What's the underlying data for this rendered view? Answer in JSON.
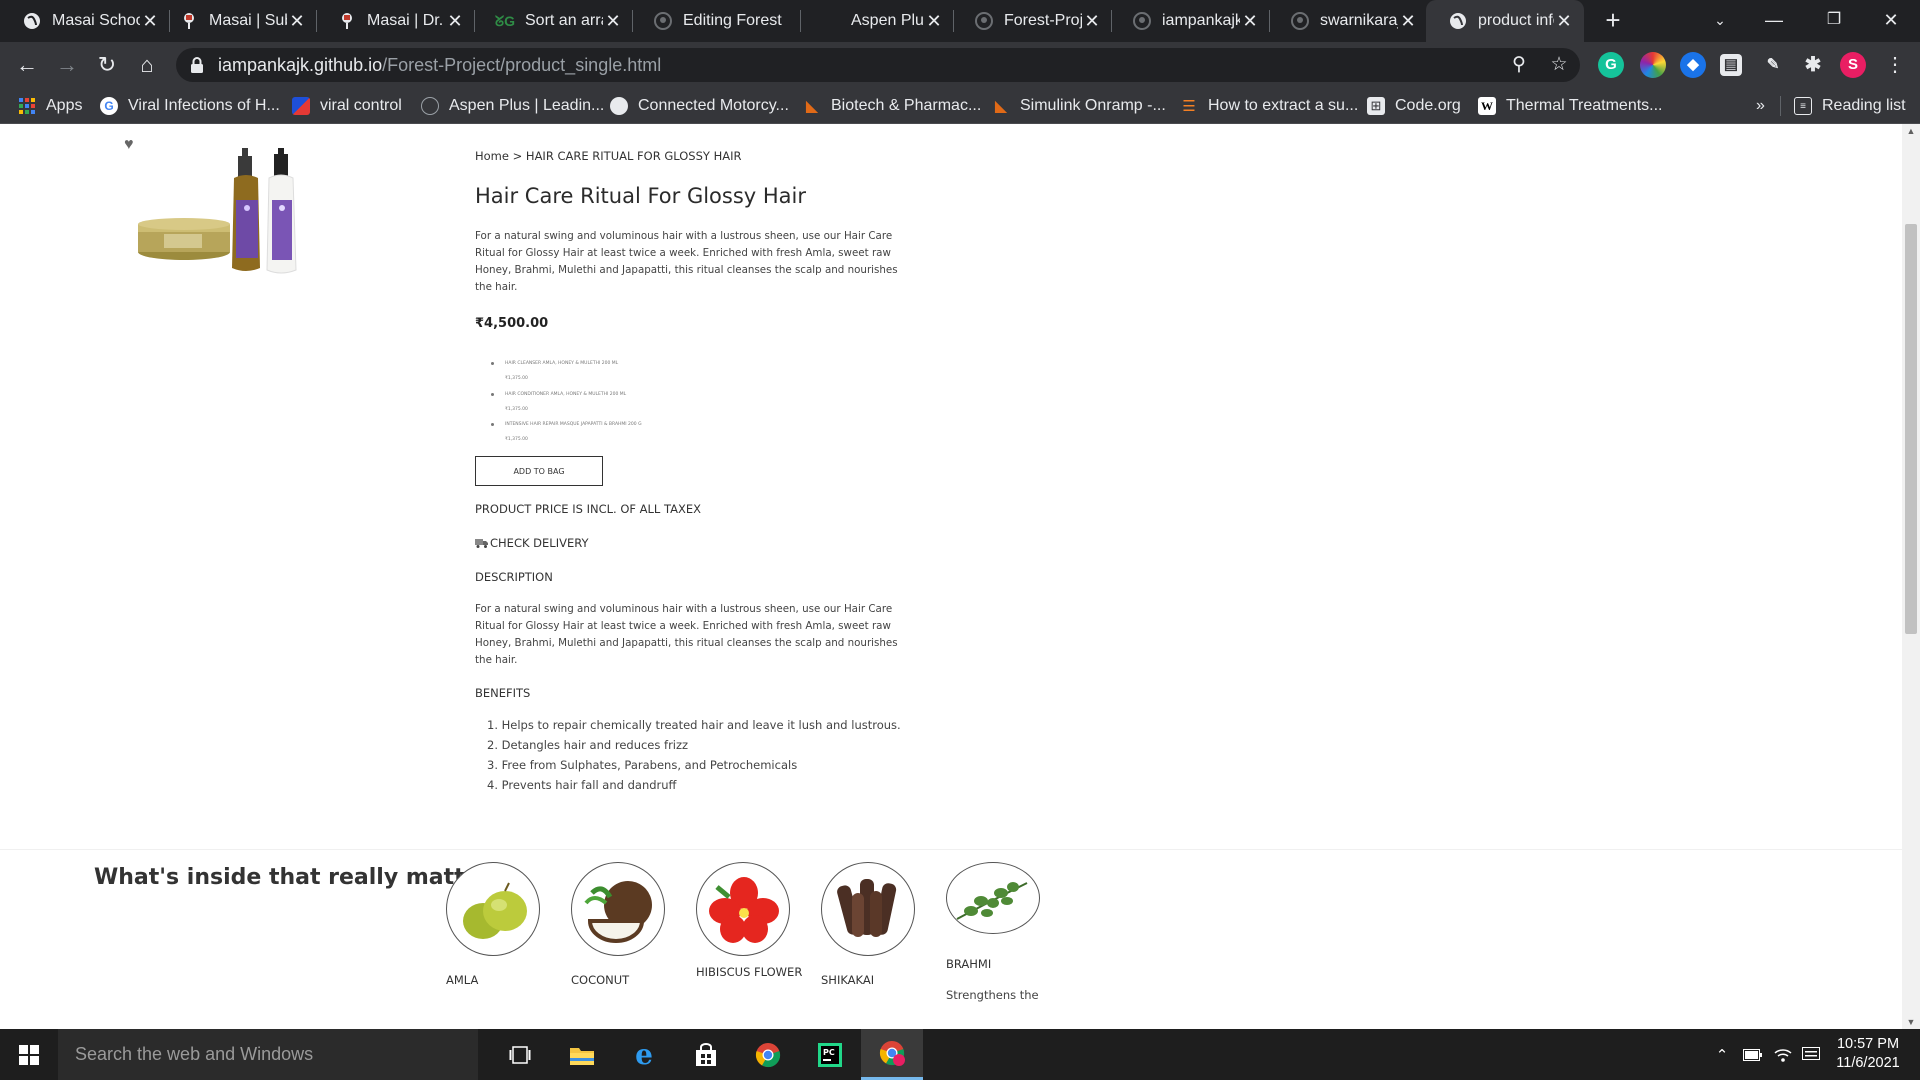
{
  "browser": {
    "tabs": [
      {
        "title": "Masai School",
        "icon": "globe-icon",
        "active": false
      },
      {
        "title": "Masai | Submissions",
        "icon": "masai-icon",
        "active": false
      },
      {
        "title": "Masai | Dr. Sorting",
        "icon": "masai-icon",
        "active": false
      },
      {
        "title": "Sort an array",
        "icon": "gfg-icon",
        "active": false
      },
      {
        "title": "Editing Forest",
        "icon": "github-icon",
        "active": false
      },
      {
        "title": "Aspen Plus",
        "icon": "aspen-icon",
        "active": false
      },
      {
        "title": "Forest-Project",
        "icon": "github-icon",
        "active": false
      },
      {
        "title": "iampankajk",
        "icon": "github-icon",
        "active": false
      },
      {
        "title": "swarnikaraj",
        "icon": "github-icon",
        "active": false
      },
      {
        "title": "product info",
        "icon": "globe-icon",
        "active": true
      }
    ],
    "url_host": "iampankajk.github.io",
    "url_path": "/Forest-Project/product_single.html",
    "profile_initial": "S",
    "bookmarks": [
      {
        "label": "Apps",
        "icon": "apps-grid-icon"
      },
      {
        "label": "Viral Infections of H...",
        "icon": "google-icon"
      },
      {
        "label": "viral control",
        "icon": "bookmark-flag-icon"
      },
      {
        "label": "Aspen Plus | Leadin...",
        "icon": "aspen-icon"
      },
      {
        "label": "Connected Motorcy...",
        "icon": "globe-icon"
      },
      {
        "label": "Biotech & Pharmac...",
        "icon": "mathworks-icon"
      },
      {
        "label": "Simulink Onramp -...",
        "icon": "mathworks-icon"
      },
      {
        "label": "How to extract a su...",
        "icon": "stackoverflow-icon"
      },
      {
        "label": "Code.org",
        "icon": "codeorg-icon"
      },
      {
        "label": "Thermal Treatments...",
        "icon": "wiki-icon"
      }
    ],
    "more_bookmarks": "»",
    "reading_list": "Reading list"
  },
  "product": {
    "breadcrumb_home": "Home",
    "breadcrumb_sep": " > ",
    "breadcrumb_current": "HAIR CARE RITUAL FOR GLOSSY HAIR",
    "title": "Hair Care Ritual For Glossy Hair",
    "description": "For a natural swing and voluminous hair with a lustrous sheen, use our Hair Care Ritual for Glossy Hair at least twice a week. Enriched with fresh Amla, sweet raw Honey, Brahmi, Mulethi and Japapatti, this ritual cleanses the scalp and nourishes the hair.",
    "price": "₹4,500.00",
    "variants": [
      {
        "name": "HAIR CLEANSER AMLA, HONEY & MULETHI 200 ML",
        "price": "₹1,375.00"
      },
      {
        "name": "HAIR CONDITIONER AMLA, HONEY & MULETHI 200 ML",
        "price": "₹1,375.00"
      },
      {
        "name": "INTENSIVE HAIR REPAIR MASQUE JAPAPATTI & BRAHMI 200 G",
        "price": "₹1,375.00"
      }
    ],
    "add_to_bag": "ADD TO BAG",
    "tax_note": "PRODUCT PRICE IS INCL. OF ALL TAXEX",
    "check_delivery": "CHECK DELIVERY",
    "description_heading": "DESCRIPTION",
    "description_body": "For a natural swing and voluminous hair with a lustrous sheen, use our Hair Care Ritual for Glossy Hair at least twice a week. Enriched with fresh Amla, sweet raw Honey, Brahmi, Mulethi and Japapatti, this ritual cleanses the scalp and nourishes the hair.",
    "benefits_heading": "BENEFITS",
    "benefits": [
      "Helps to repair chemically treated hair and leave it lush and lustrous.",
      "Detangles hair and reduces frizz",
      "Free from Sulphates, Parabens, and Petrochemicals",
      "Prevents hair fall and dandruff"
    ]
  },
  "ingredients": {
    "heading": "What's inside that really matters",
    "items": [
      {
        "name": "AMLA",
        "desc": ""
      },
      {
        "name": "COCONUT",
        "desc": ""
      },
      {
        "name": "HIBISCUS FLOWER",
        "desc": ""
      },
      {
        "name": "SHIKAKAI",
        "desc": ""
      },
      {
        "name": "BRAHMI",
        "desc": "Strengthens the"
      }
    ]
  },
  "taskbar": {
    "search_placeholder": "Search the web and Windows",
    "time": "10:57 PM",
    "date": "11/6/2021"
  }
}
